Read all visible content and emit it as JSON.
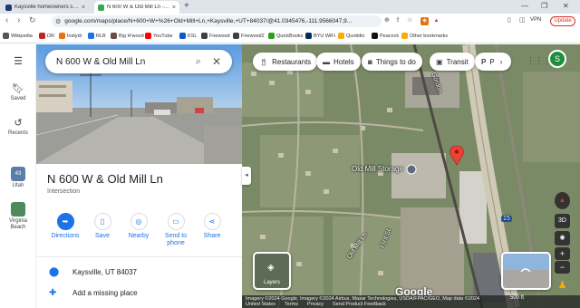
{
  "browser": {
    "tabs": [
      {
        "title": "Kaysville homeowners show up in d",
        "favicon_color": "#1a3c6e"
      },
      {
        "title": "N 600 W & Old Mill Ln - Google",
        "favicon_color": "#34a853"
      }
    ],
    "new_tab": "+",
    "url": "google.com/maps/place/N+600+W+%26+Old+Mill+Ln,+Kaysville,+UT+84037/@41.0345476,-111.9566047,9...",
    "vpn_label": "VPN",
    "update_label": "Update",
    "bookmarks": [
      {
        "label": "Wikipedia",
        "color": "#555"
      },
      {
        "label": "DR",
        "color": "#c5221f"
      },
      {
        "label": "Instydr",
        "color": "#e8710a"
      },
      {
        "label": "RLB",
        "color": "#1a73e8"
      },
      {
        "label": "Big H'wood",
        "color": "#6d4c41"
      },
      {
        "label": "YouTube",
        "color": "#ff0000"
      },
      {
        "label": "KSL",
        "color": "#0b57d0"
      },
      {
        "label": "Firewood",
        "color": "#3c4043"
      },
      {
        "label": "Firewood2",
        "color": "#3c4043"
      },
      {
        "label": "QuickBooks",
        "color": "#2ca01c"
      },
      {
        "label": "BYU WiFi",
        "color": "#002e5d"
      },
      {
        "label": "Quotidio",
        "color": "#f9ab00"
      },
      {
        "label": "Peacock",
        "color": "#111"
      },
      {
        "label": "Other bookmarks",
        "color": "#f9ab00"
      }
    ]
  },
  "rail": {
    "saved": "Saved",
    "recents": "Recents",
    "places": [
      {
        "label": "Utah",
        "badge": "43",
        "color": "#5a7ea8"
      },
      {
        "label": "Virginia Beach",
        "color": "#4e8a5c"
      }
    ]
  },
  "panel": {
    "search_query": "N 600 W & Old Mill Ln",
    "title": "N 600 W & Old Mill Ln",
    "subtitle": "Intersection",
    "actions": [
      {
        "label": "Directions",
        "icon": "directions-icon"
      },
      {
        "label": "Save",
        "icon": "bookmark-icon"
      },
      {
        "label": "Nearby",
        "icon": "nearby-icon"
      },
      {
        "label": "Send to phone",
        "icon": "phone-icon"
      },
      {
        "label": "Share",
        "icon": "share-icon"
      }
    ],
    "address": "Kaysville, UT 84037",
    "add_place": "Add a missing place"
  },
  "map": {
    "chips": [
      {
        "label": "Restaurants",
        "icon": "fork-knife-icon"
      },
      {
        "label": "Hotels",
        "icon": "bed-icon"
      },
      {
        "label": "Things to do",
        "icon": "camera-icon"
      },
      {
        "label": "Transit",
        "icon": "bus-icon"
      },
      {
        "label": "P",
        "icon": "parking-icon"
      }
    ],
    "avatar_letter": "S",
    "place_labels": {
      "storage": "Old Mill Storage",
      "road_a": "Gordon",
      "road_b": "Old Mill Ln",
      "road_c": "Flint St",
      "highway": "15"
    },
    "layers_label": "Layers",
    "zoom_3d": "3D",
    "zoom_in": "+",
    "zoom_out": "−",
    "google_word": "Google",
    "attribution_1": "Imagery ©2024 Google, Imagery ©2024 Airbus, Maxar Technologies, USDA/FPAC/GEO, Map data ©2024",
    "attribution_links": [
      "United States",
      "Terms",
      "Privacy",
      "Send Product Feedback"
    ],
    "scale": "500 ft"
  }
}
